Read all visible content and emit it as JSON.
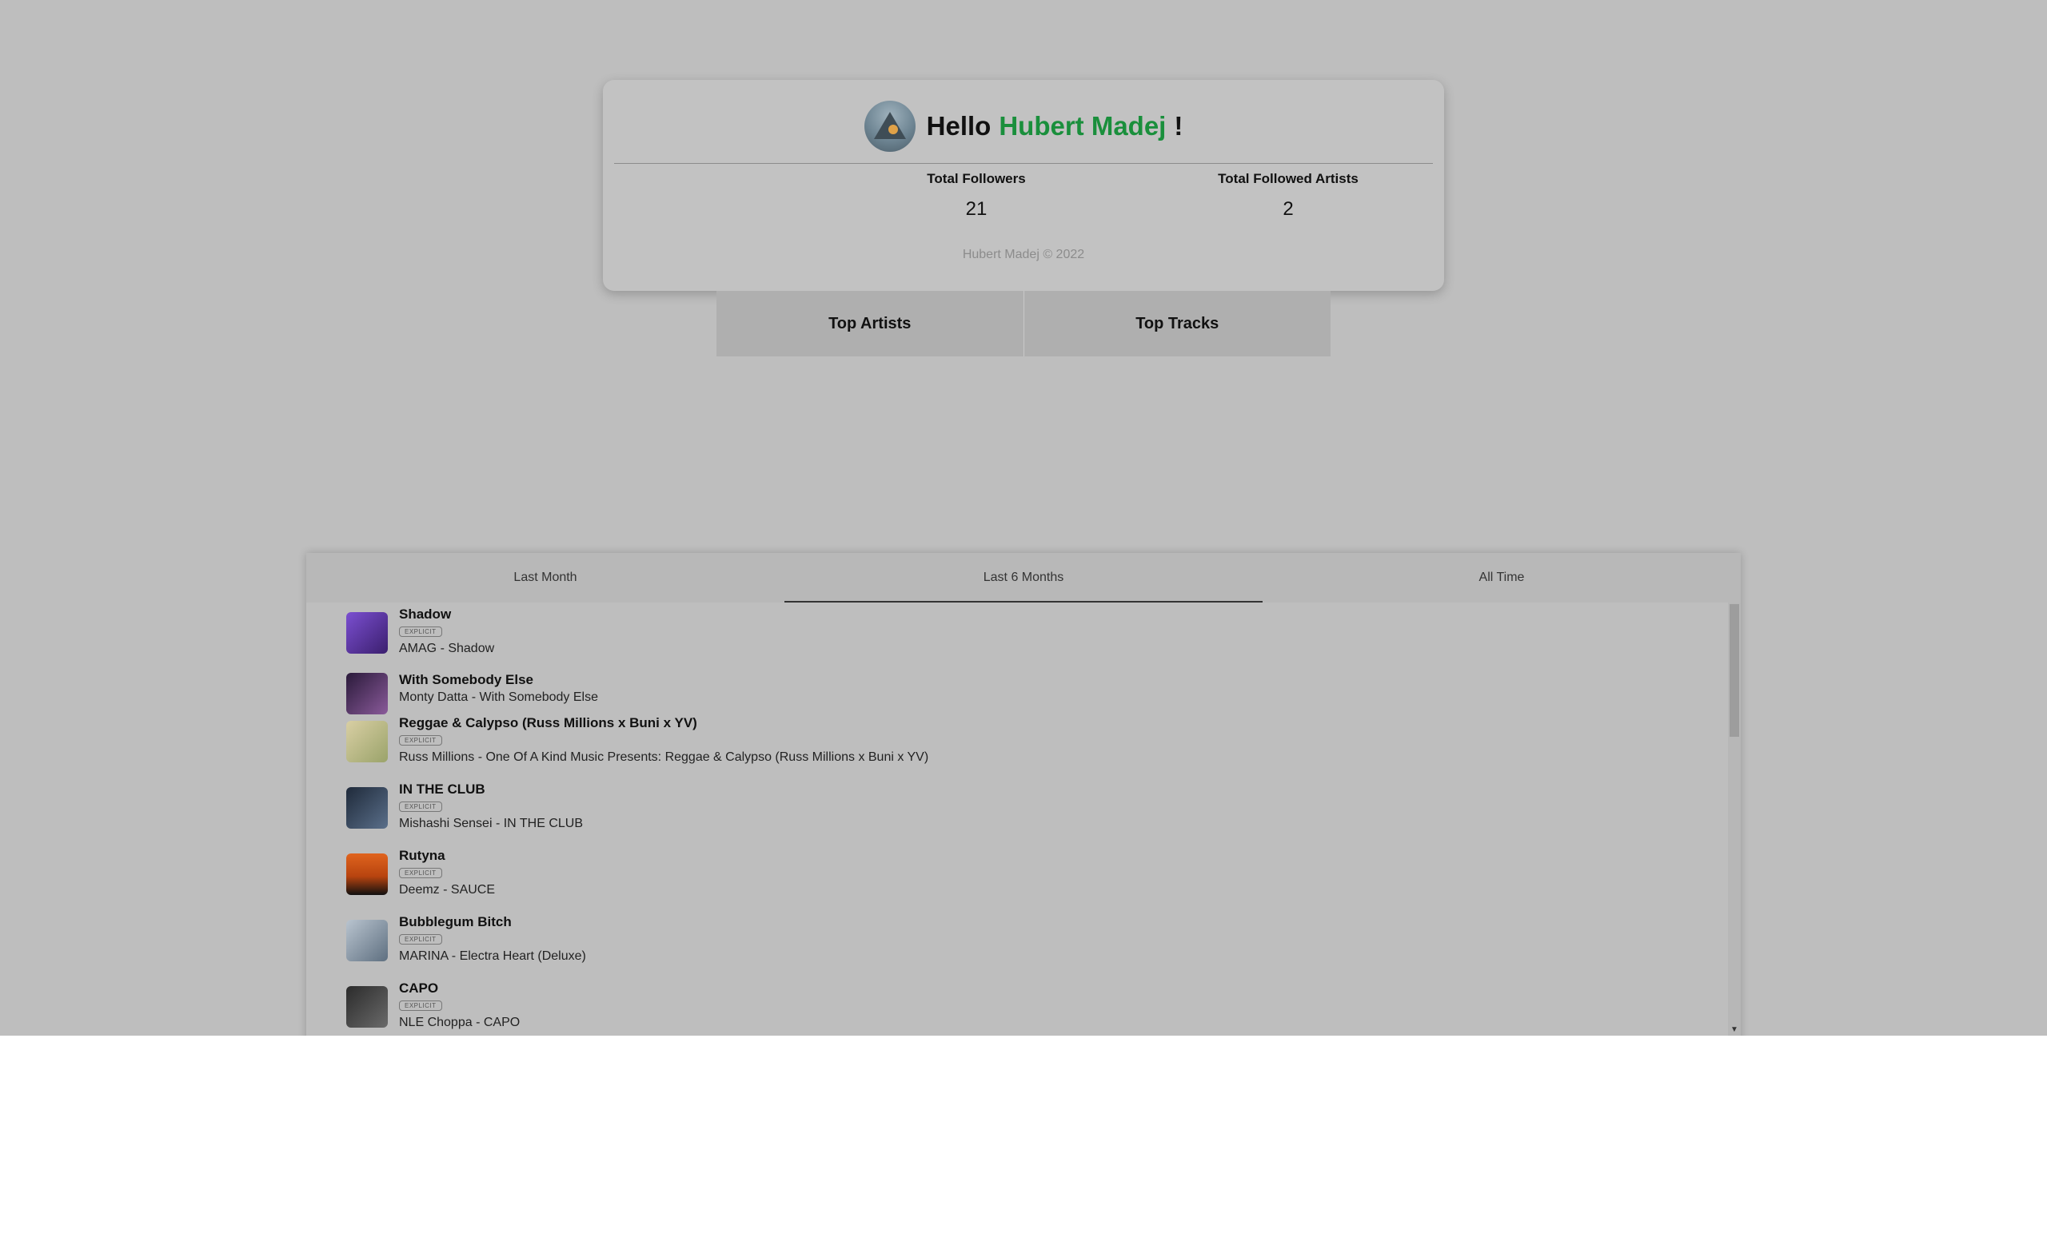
{
  "profile": {
    "greeting": "Hello",
    "name": "Hubert Madej",
    "exclaim": "!",
    "stats": [
      {
        "label": "Total Followers",
        "value": "21"
      },
      {
        "label": "Total Followed Artists",
        "value": "2"
      }
    ],
    "copyright": "Hubert Madej © 2022"
  },
  "toggle": {
    "artists": "Top Artists",
    "tracks": "Top Tracks"
  },
  "tabs": [
    {
      "label": "Last Month",
      "active": false
    },
    {
      "label": "Last 6 Months",
      "active": true
    },
    {
      "label": "All Time",
      "active": false
    }
  ],
  "tracks": [
    {
      "title": "Shadow",
      "explicit": "EXPLICIT",
      "subtitle": "AMAG - Shadow"
    },
    {
      "title": "With Somebody Else",
      "explicit": "",
      "subtitle": "Monty Datta - With Somebody Else"
    },
    {
      "title": "Reggae & Calypso (Russ Millions x Buni x YV)",
      "explicit": "EXPLICIT",
      "subtitle": "Russ Millions - One Of A Kind Music Presents: Reggae & Calypso (Russ Millions x Buni x YV)"
    },
    {
      "title": "IN THE CLUB",
      "explicit": "EXPLICIT",
      "subtitle": "Mishashi Sensei - IN THE CLUB"
    },
    {
      "title": "Rutyna",
      "explicit": "EXPLICIT",
      "subtitle": "Deemz - SAUCE"
    },
    {
      "title": "Bubblegum Bitch",
      "explicit": "EXPLICIT",
      "subtitle": "MARINA - Electra Heart (Deluxe)"
    },
    {
      "title": "CAPO",
      "explicit": "EXPLICIT",
      "subtitle": "NLE Choppa - CAPO"
    }
  ],
  "colors": {
    "accent": "#1a8f3c",
    "background": "#bebebe",
    "toggle": "#afafaf"
  }
}
